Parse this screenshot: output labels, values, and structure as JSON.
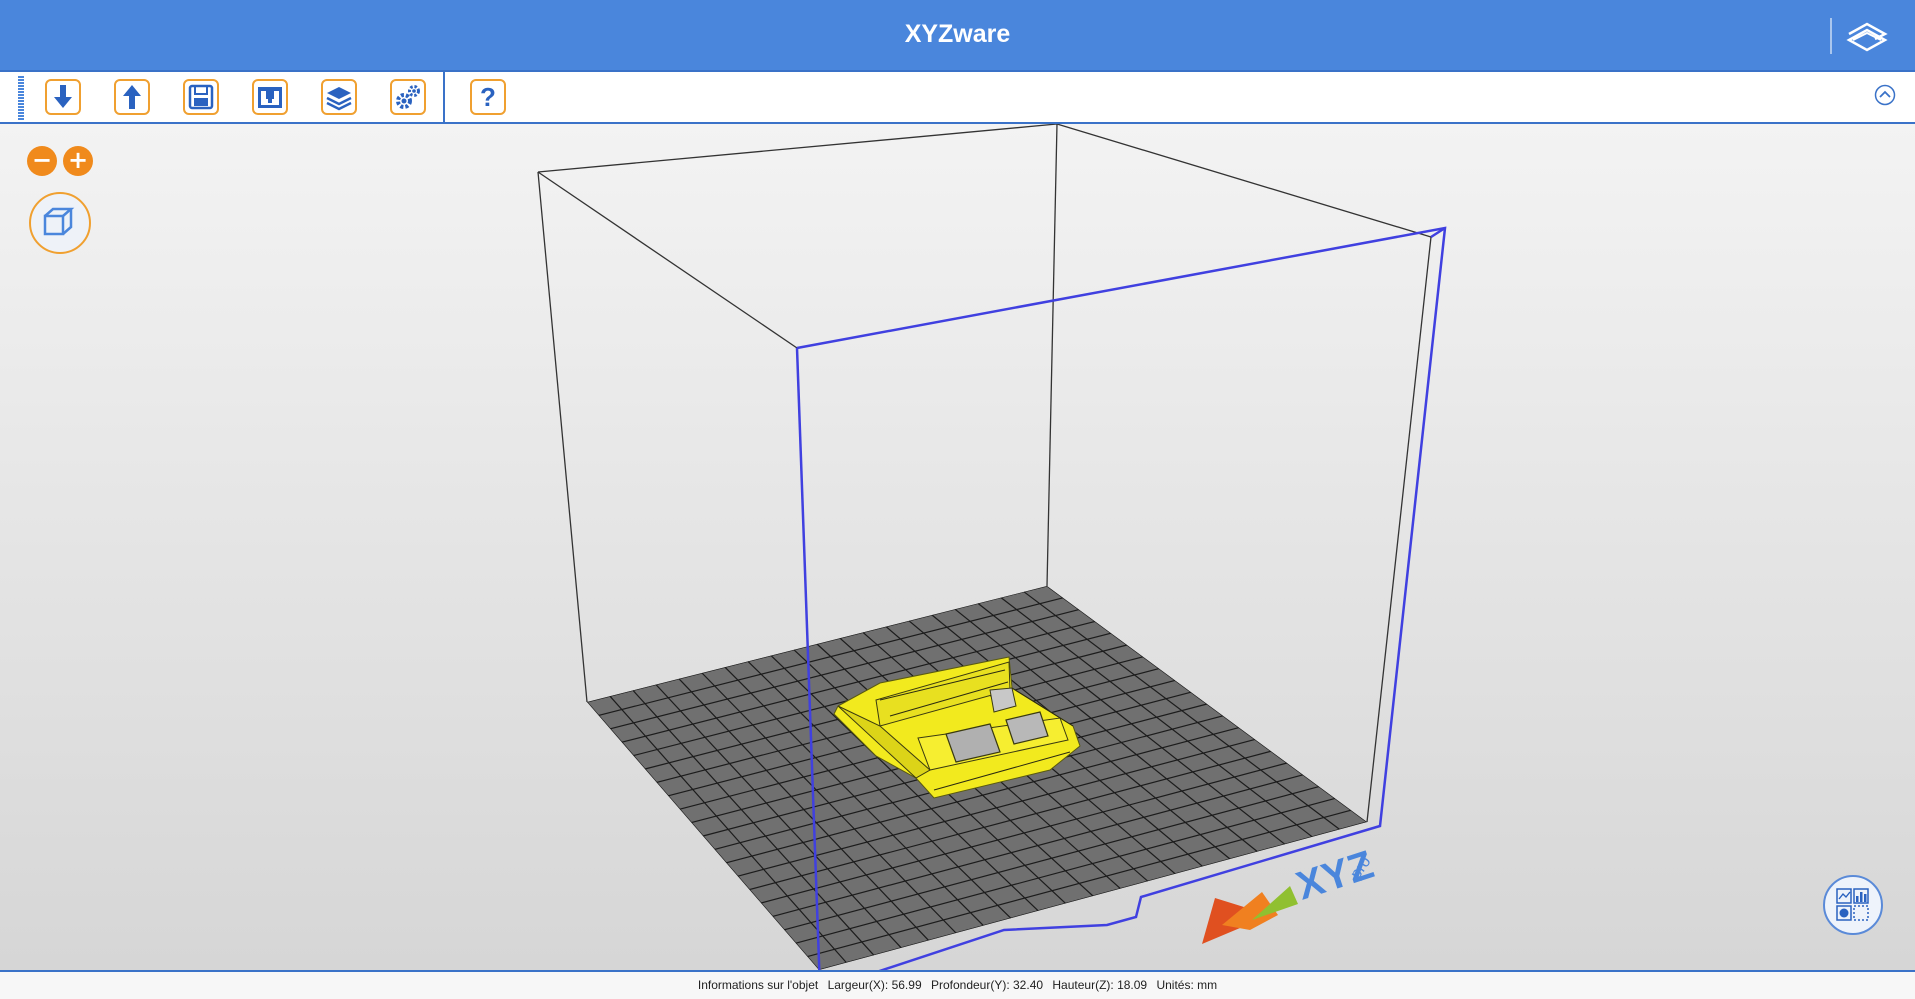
{
  "app": {
    "title": "XYZware",
    "brand_icon": "layers-logo-icon"
  },
  "toolbar": {
    "buttons": [
      {
        "name": "import-button",
        "icon": "arrow-down-icon"
      },
      {
        "name": "export-button",
        "icon": "arrow-up-icon"
      },
      {
        "name": "save-button",
        "icon": "floppy-disk-icon"
      },
      {
        "name": "print-button",
        "icon": "printer-icon"
      },
      {
        "name": "layers-button",
        "icon": "layers-icon"
      },
      {
        "name": "settings-button",
        "icon": "gears-icon"
      }
    ],
    "help_label": "?",
    "collapse_icon": "chevron-up-circle-icon"
  },
  "viewport": {
    "zoom_out_label": "−",
    "zoom_in_label": "+",
    "view_icon": "cube-icon",
    "stats_icon": "chart-panel-icon",
    "logo_text": "XYZ",
    "logo_subtext": "pro",
    "model_color": "#f2ea1e",
    "frame_color": "#4040e0",
    "bed_color": "#707070"
  },
  "status": {
    "info_label": "Informations sur l'objet",
    "width": "Largeur(X): 56.99",
    "depth": "Profondeur(Y): 32.40",
    "height": "Hauteur(Z): 18.09",
    "units": "Unités: mm"
  }
}
